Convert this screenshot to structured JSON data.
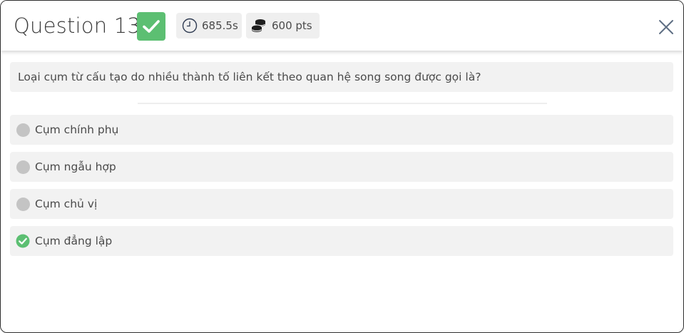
{
  "header": {
    "title": "Question 13",
    "time": "685.5s",
    "points": "600 pts"
  },
  "question": {
    "text": "Loại cụm từ cấu tạo do nhiều thành tố liên kết theo quan hệ song song được gọi là?"
  },
  "options": [
    {
      "label": "Cụm chính phụ",
      "correct": false
    },
    {
      "label": "Cụm ngẫu hợp",
      "correct": false
    },
    {
      "label": "Cụm chủ vị",
      "correct": false
    },
    {
      "label": "Cụm đẳng lập",
      "correct": true
    }
  ],
  "colors": {
    "correct_green": "#5cbf72",
    "option_bg": "#f2f2f2",
    "unselected_dot": "#c4c4c4"
  },
  "icons": {
    "status": "checkmark-icon",
    "time": "clock-icon",
    "points": "coins-icon",
    "close": "close-icon",
    "correct_option": "check-circle-icon"
  }
}
